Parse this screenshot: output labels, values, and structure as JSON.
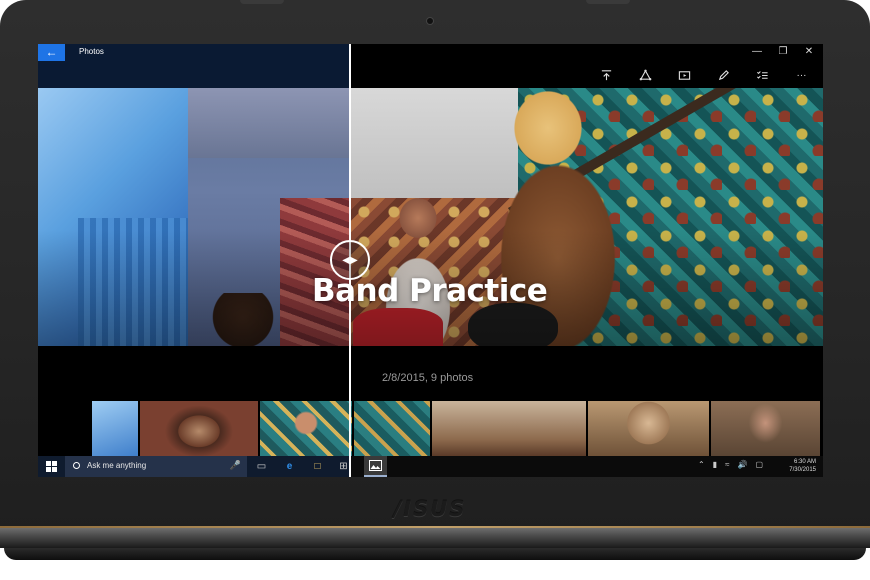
{
  "device": {
    "brand_logo": "/ISUS"
  },
  "app": {
    "title": "Photos",
    "back_icon": "back-arrow-icon"
  },
  "window_controls": {
    "minimize": "minimize-icon",
    "maximize": "maximize-icon",
    "close": "close-icon"
  },
  "toolbar": {
    "items": [
      "share-icon",
      "enhance-icon",
      "slideshow-icon",
      "edit-icon",
      "select-icon",
      "more-icon"
    ],
    "more_label": "···"
  },
  "album": {
    "title": "Band Practice",
    "meta": "2/8/2015, 9 photos"
  },
  "thumbnails": {
    "count": 7
  },
  "taskbar": {
    "search_placeholder": "Ask me anything",
    "icons": [
      "windows-start-icon",
      "cortana-icon",
      "microphone-icon",
      "task-view-icon",
      "edge-icon",
      "file-explorer-icon",
      "store-icon",
      "photos-icon"
    ],
    "tray": [
      "chevron-up-icon",
      "battery-icon",
      "wifi-icon",
      "volume-icon",
      "action-center-icon"
    ],
    "time": "6:30 AM",
    "date": "7/30/2015"
  },
  "colors": {
    "accent": "#1e74e6",
    "titlebar_left": "#0a1a33",
    "taskbar_search": "#25324a"
  }
}
